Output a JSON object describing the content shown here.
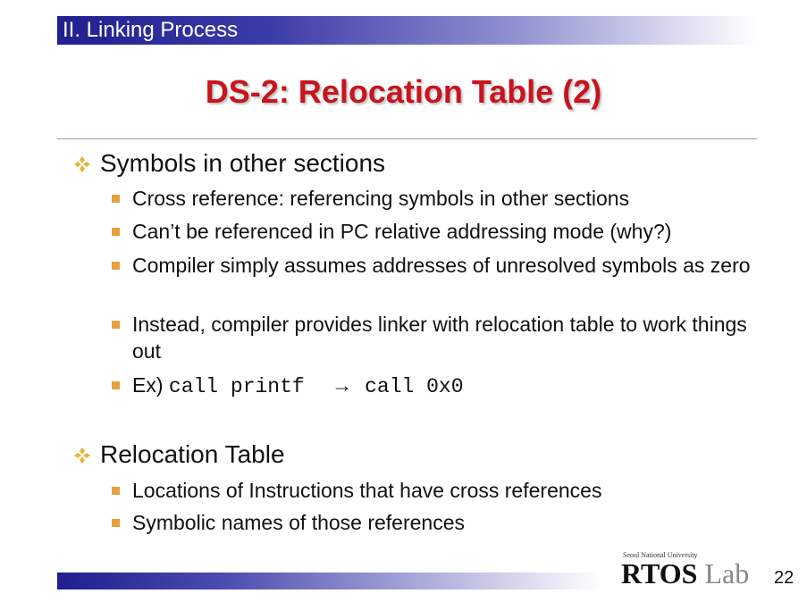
{
  "header": {
    "section": "II. Linking Process"
  },
  "title": "DS-2: Relocation Table (2)",
  "bullets": [
    {
      "text": "Symbols in other sections",
      "sub": [
        {
          "text": "Cross reference: referencing symbols in other sections"
        },
        {
          "text": "Can’t be referenced in PC relative addressing mode (why?)"
        },
        {
          "text": "Compiler simply assumes addresses of unresolved symbols as zero"
        },
        {
          "text": "Instead, compiler provides linker with relocation table to work things out"
        },
        {
          "prefix": "Ex) ",
          "code_from": "call printf",
          "arrow": "→",
          "code_to": "call 0x0"
        }
      ]
    },
    {
      "text": "Relocation Table",
      "sub": [
        {
          "text": "Locations of Instructions that have cross references"
        },
        {
          "text": "Symbolic names of those references"
        }
      ]
    }
  ],
  "footer": {
    "logo_small": "Seoul National University",
    "logo_main": "RTOS",
    "logo_lab": " Lab",
    "page_number": "22"
  },
  "colors": {
    "title": "#c8141e",
    "header_bar": "#1f1f8f",
    "bullet_square": "#e7a03b",
    "bullet_diamond": "#e7b53b"
  }
}
